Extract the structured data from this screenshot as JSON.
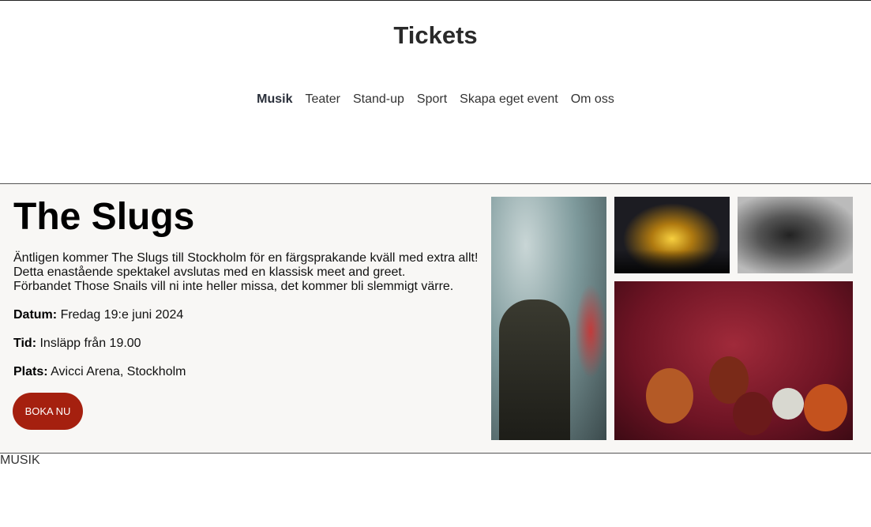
{
  "header": {
    "title": "Tickets"
  },
  "nav": {
    "items": [
      {
        "label": "Musik",
        "active": true
      },
      {
        "label": "Teater"
      },
      {
        "label": "Stand-up"
      },
      {
        "label": "Sport"
      },
      {
        "label": "Skapa eget event"
      },
      {
        "label": "Om oss"
      }
    ]
  },
  "event": {
    "title": "The Slugs",
    "description": [
      "Äntligen kommer The Slugs till Stockholm för en färgsprakande kväll med extra allt!",
      "Detta enastående spektakel avslutas med en klassisk meet and greet.",
      "Förbandet Those Snails vill ni inte heller missa, det kommer bli slemmigt värre."
    ],
    "date_label": "Datum:",
    "date_value": "Fredag 19:e juni 2024",
    "time_label": "Tid:",
    "time_value": "Insläpp från 19.00",
    "place_label": "Plats:",
    "place_value": "Avicci Arena, Stockholm",
    "book_button": "BOKA NU",
    "button_color": "#a5200f"
  },
  "section_label": "MUSIK"
}
